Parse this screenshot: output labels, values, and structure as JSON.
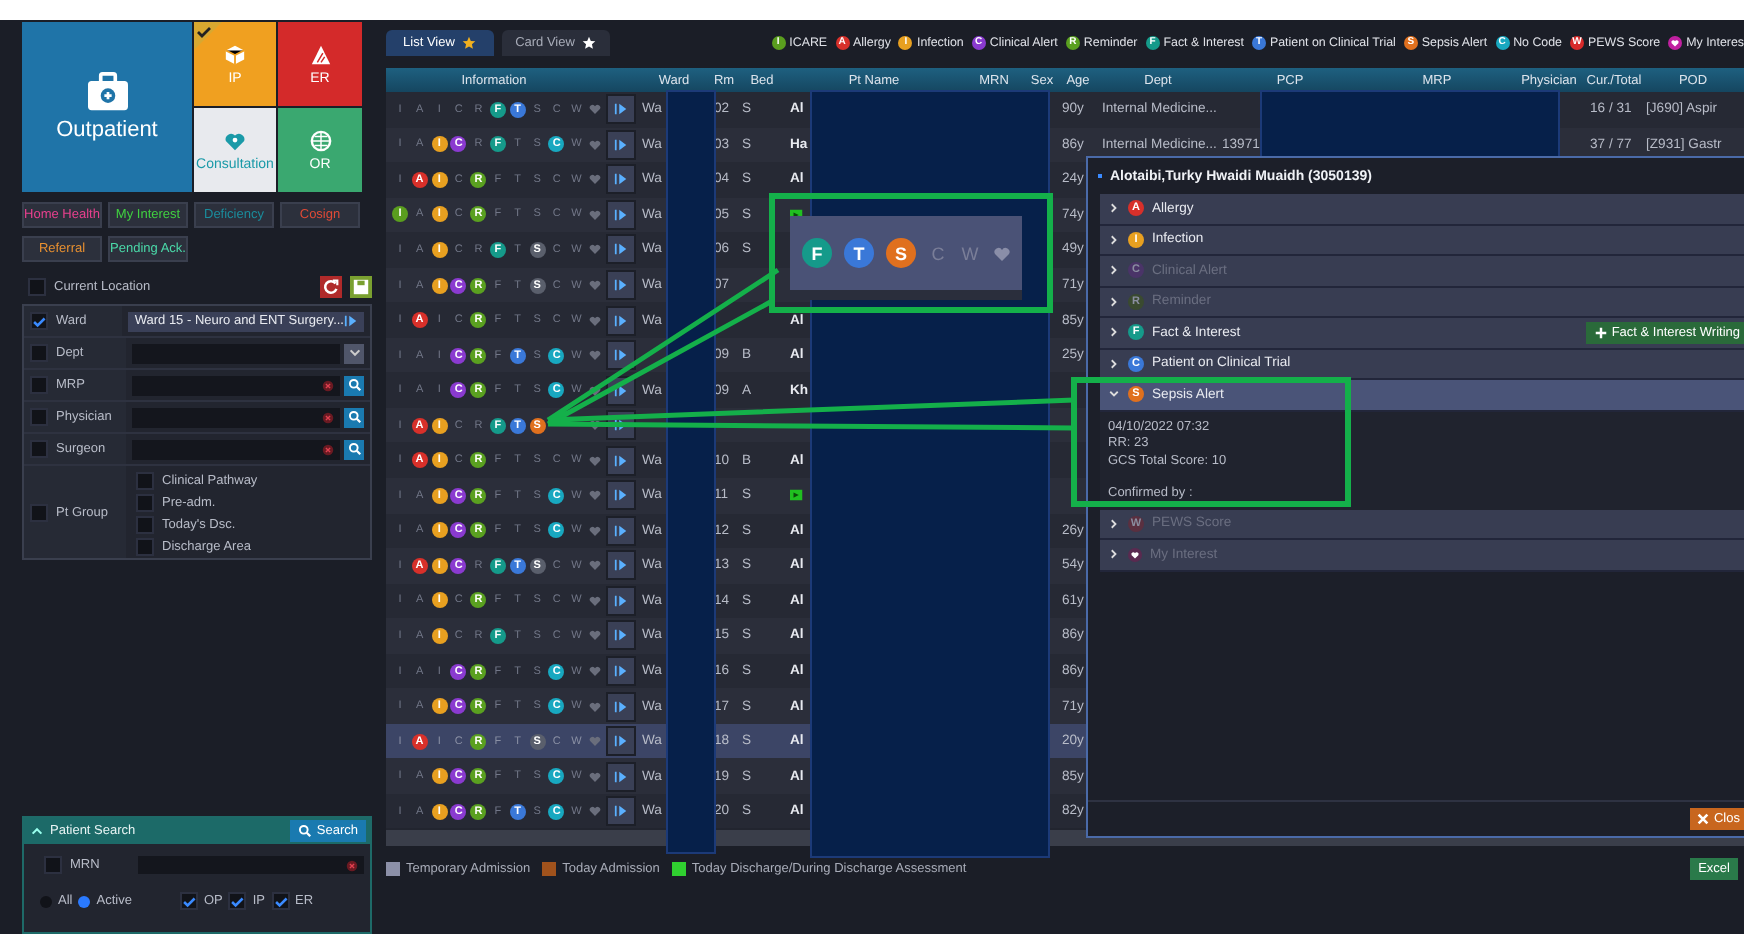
{
  "tiles": [
    {
      "label": "Outpatient",
      "color": "#1f74a8",
      "kind": "large",
      "checked": false
    },
    {
      "label": "IP",
      "color": "#f0a020",
      "kind": "small",
      "checked": true
    },
    {
      "label": "ER",
      "color": "#d42a2a",
      "kind": "small",
      "checked": false
    },
    {
      "label": "Consultation",
      "color": "#e8eaee",
      "kind": "light",
      "checked": false
    },
    {
      "label": "OR",
      "color": "#3aa870",
      "kind": "small",
      "checked": false
    }
  ],
  "quick_buttons": [
    {
      "label": "Home Health",
      "color": "#e8408e"
    },
    {
      "label": "My Interest",
      "color": "#40d040"
    },
    {
      "label": "Deficiency",
      "color": "#1a8c9c"
    },
    {
      "label": "Cosign",
      "color": "#e04a36"
    },
    {
      "label": "Referral",
      "color": "#e89030"
    },
    {
      "label": "Pending Ack.",
      "color": "#4ad8a8"
    }
  ],
  "current_location": {
    "label": "Current Location",
    "checked": false
  },
  "filters": [
    {
      "label": "Ward",
      "checked": true,
      "kind": "select",
      "value": "Ward 15 - Neuro and ENT Surgery..."
    },
    {
      "label": "Dept",
      "checked": false,
      "kind": "dropdown"
    },
    {
      "label": "MRP",
      "checked": false,
      "kind": "search"
    },
    {
      "label": "Physician",
      "checked": false,
      "kind": "search"
    },
    {
      "label": "Surgeon",
      "checked": false,
      "kind": "search"
    },
    {
      "label": "Pt Group",
      "checked": false,
      "kind": "group",
      "options": [
        {
          "label": "Clinical Pathway",
          "checked": false
        },
        {
          "label": "Pre-adm.",
          "checked": false
        },
        {
          "label": "Today's Dsc.",
          "checked": false
        },
        {
          "label": "Discharge Area",
          "checked": false
        }
      ]
    }
  ],
  "patient_search": {
    "title": "Patient Search",
    "button": "Search",
    "mrn": {
      "label": "MRN",
      "checked": false
    },
    "scope": [
      {
        "label": "All",
        "selected": false
      },
      {
        "label": "Active",
        "selected": true
      }
    ],
    "types": [
      {
        "label": "OP",
        "checked": true
      },
      {
        "label": "IP",
        "checked": true
      },
      {
        "label": "ER",
        "checked": true
      }
    ]
  },
  "view_tabs": [
    {
      "label": "List View",
      "selected": true
    },
    {
      "label": "Card View",
      "selected": false
    }
  ],
  "legend": [
    {
      "label": "ICARE",
      "badge": "I",
      "color": "#5a9e1e",
      "kind": "letter"
    },
    {
      "label": "Allergy",
      "badge": "A",
      "color": "#d8302a",
      "kind": "letter"
    },
    {
      "label": "Infection",
      "badge": "I",
      "color": "#e8a020",
      "kind": "letter"
    },
    {
      "label": "Clinical Alert",
      "badge": "C",
      "color": "#8a3ad0",
      "kind": "letter"
    },
    {
      "label": "Reminder",
      "badge": "R",
      "color": "#5aa020",
      "kind": "letter"
    },
    {
      "label": "Fact & Interest",
      "badge": "F",
      "color": "#159a8a",
      "kind": "letter"
    },
    {
      "label": "Patient on Clinical Trial",
      "badge": "T",
      "color": "#3a78d8",
      "kind": "letter"
    },
    {
      "label": "Sepsis Alert",
      "badge": "S",
      "color": "#e0701e",
      "kind": "letter"
    },
    {
      "label": "No Code",
      "badge": "C",
      "color": "#18a8c0",
      "kind": "letter"
    },
    {
      "label": "PEWS Score",
      "badge": "W",
      "color": "#d82a2a",
      "kind": "letter"
    },
    {
      "label": "My Interes",
      "color": "#c020a0",
      "kind": "heart"
    }
  ],
  "columns": [
    "Information",
    "Ward",
    "Rm",
    "Bed",
    "Pt Name",
    "MRN",
    "Sex",
    "Age",
    "Dept",
    "PCP",
    "MRP",
    "Physician",
    "Cur./Total",
    "POD"
  ],
  "rows": [
    {
      "info": [
        {
          "letter": "I",
          "on": false
        },
        {
          "letter": "A",
          "on": false
        },
        {
          "letter": "I",
          "on": false
        },
        {
          "letter": "C",
          "on": false
        },
        {
          "letter": "R",
          "on": false
        },
        {
          "letter": "F",
          "on": true
        },
        {
          "letter": "T",
          "on": true
        },
        {
          "letter": "S",
          "on": false
        },
        {
          "letter": "C",
          "on": false
        },
        {
          "letter": "W",
          "on": false
        }
      ],
      "ward": "Wa",
      "rm": "02",
      "bed": "S",
      "name": "Al",
      "flag": false,
      "age": "90y",
      "dept": "Internal Medicine...",
      "cur_total": "16 / 31",
      "pod": "[J690] Aspir",
      "selected": false
    },
    {
      "info": [
        {
          "letter": "I",
          "on": false
        },
        {
          "letter": "A",
          "on": false
        },
        {
          "letter": "I",
          "on": true
        },
        {
          "letter": "C",
          "on": true
        },
        {
          "letter": "R",
          "on": false
        },
        {
          "letter": "F",
          "on": true
        },
        {
          "letter": "T",
          "on": false
        },
        {
          "letter": "S",
          "on": false
        },
        {
          "letter": "C",
          "on": true
        },
        {
          "letter": "W",
          "on": false
        }
      ],
      "ward": "Wa",
      "rm": "03",
      "bed": "S",
      "name": "Ha",
      "flag": false,
      "age": "86y",
      "dept": "Internal Medicine...",
      "pcp": "13971",
      "cur_total": "37 / 77",
      "pod": "[Z931] Gastr",
      "selected": false
    },
    {
      "info": [
        {
          "letter": "I",
          "on": false
        },
        {
          "letter": "A",
          "on": true
        },
        {
          "letter": "I",
          "on": true
        },
        {
          "letter": "C",
          "on": false
        },
        {
          "letter": "R",
          "on": true
        },
        {
          "letter": "F",
          "on": false
        },
        {
          "letter": "T",
          "on": false
        },
        {
          "letter": "S",
          "on": false
        },
        {
          "letter": "C",
          "on": false
        },
        {
          "letter": "W",
          "on": false
        }
      ],
      "ward": "Wa",
      "rm": "04",
      "bed": "S",
      "name": "Al",
      "flag": false,
      "age": "24y",
      "selected": false
    },
    {
      "info": [
        {
          "letter": "I",
          "on": true
        },
        {
          "letter": "A",
          "on": false
        },
        {
          "letter": "I",
          "on": true
        },
        {
          "letter": "C",
          "on": false
        },
        {
          "letter": "R",
          "on": true
        },
        {
          "letter": "F",
          "on": false
        },
        {
          "letter": "T",
          "on": false
        },
        {
          "letter": "S",
          "on": false
        },
        {
          "letter": "C",
          "on": false
        },
        {
          "letter": "W",
          "on": false
        }
      ],
      "ward": "Wa",
      "rm": "05",
      "bed": "S",
      "flag": true,
      "age": "74y",
      "selected": false
    },
    {
      "info": [
        {
          "letter": "I",
          "on": false
        },
        {
          "letter": "A",
          "on": false
        },
        {
          "letter": "I",
          "on": true
        },
        {
          "letter": "C",
          "on": false
        },
        {
          "letter": "R",
          "on": false
        },
        {
          "letter": "F",
          "on": true
        },
        {
          "letter": "T",
          "on": false
        },
        {
          "letter": "S",
          "on": false,
          "muted": true
        },
        {
          "letter": "C",
          "on": false
        },
        {
          "letter": "W",
          "on": false
        }
      ],
      "ward": "Wa",
      "rm": "06",
      "bed": "S",
      "flag": false,
      "age": "49y",
      "selected": false
    },
    {
      "info": [
        {
          "letter": "I",
          "on": false
        },
        {
          "letter": "A",
          "on": false
        },
        {
          "letter": "I",
          "on": true
        },
        {
          "letter": "C",
          "on": true
        },
        {
          "letter": "R",
          "on": true
        },
        {
          "letter": "F",
          "on": false
        },
        {
          "letter": "T",
          "on": false
        },
        {
          "letter": "S",
          "on": false,
          "muted": true
        },
        {
          "letter": "C",
          "on": false
        },
        {
          "letter": "W",
          "on": false
        }
      ],
      "ward": "Wa",
      "rm": "07",
      "flag": false,
      "age": "71y",
      "selected": false
    },
    {
      "info": [
        {
          "letter": "I",
          "on": false
        },
        {
          "letter": "A",
          "on": true
        },
        {
          "letter": "I",
          "on": false
        },
        {
          "letter": "C",
          "on": false
        },
        {
          "letter": "R",
          "on": true
        },
        {
          "letter": "F",
          "on": false
        },
        {
          "letter": "T",
          "on": false
        },
        {
          "letter": "S",
          "on": false
        },
        {
          "letter": "C",
          "on": false
        },
        {
          "letter": "W",
          "on": false
        }
      ],
      "ward": "Wa",
      "name": "Al",
      "flag": false,
      "age": "85y",
      "selected": false
    },
    {
      "info": [
        {
          "letter": "I",
          "on": false
        },
        {
          "letter": "A",
          "on": false
        },
        {
          "letter": "I",
          "on": false
        },
        {
          "letter": "C",
          "on": true
        },
        {
          "letter": "R",
          "on": true
        },
        {
          "letter": "F",
          "on": false
        },
        {
          "letter": "T",
          "on": true
        },
        {
          "letter": "S",
          "on": false
        },
        {
          "letter": "C",
          "on": true
        },
        {
          "letter": "W",
          "on": false
        }
      ],
      "rm": "09",
      "bed": "B",
      "name": "Al",
      "flag": false,
      "age": "25y",
      "selected": false
    },
    {
      "info": [
        {
          "letter": "I",
          "on": false
        },
        {
          "letter": "A",
          "on": false
        },
        {
          "letter": "I",
          "on": false
        },
        {
          "letter": "C",
          "on": true
        },
        {
          "letter": "R",
          "on": true
        },
        {
          "letter": "F",
          "on": false
        },
        {
          "letter": "T",
          "on": false
        },
        {
          "letter": "S",
          "on": false
        },
        {
          "letter": "C",
          "on": true
        },
        {
          "letter": "W",
          "on": false
        }
      ],
      "ward": "Wa",
      "rm": "09",
      "bed": "A",
      "name": "Kh",
      "flag": false,
      "selected": false
    },
    {
      "info": [
        {
          "letter": "I",
          "on": false
        },
        {
          "letter": "A",
          "on": true
        },
        {
          "letter": "I",
          "on": true
        },
        {
          "letter": "C",
          "on": false
        },
        {
          "letter": "R",
          "on": false
        },
        {
          "letter": "F",
          "on": true
        },
        {
          "letter": "T",
          "on": true
        },
        {
          "letter": "S",
          "on": true
        }
      ],
      "flag": false,
      "selected": false
    },
    {
      "info": [
        {
          "letter": "I",
          "on": false
        },
        {
          "letter": "A",
          "on": true
        },
        {
          "letter": "I",
          "on": true
        },
        {
          "letter": "C",
          "on": false
        },
        {
          "letter": "R",
          "on": true
        },
        {
          "letter": "F",
          "on": false
        },
        {
          "letter": "T",
          "on": false
        },
        {
          "letter": "S",
          "on": false
        },
        {
          "letter": "C",
          "on": false
        },
        {
          "letter": "W",
          "on": false
        }
      ],
      "ward": "Wa",
      "rm": "10",
      "bed": "B",
      "name": "Al",
      "flag": false,
      "selected": false
    },
    {
      "info": [
        {
          "letter": "I",
          "on": false
        },
        {
          "letter": "A",
          "on": false
        },
        {
          "letter": "I",
          "on": true
        },
        {
          "letter": "C",
          "on": true
        },
        {
          "letter": "R",
          "on": true
        },
        {
          "letter": "F",
          "on": false
        },
        {
          "letter": "T",
          "on": false
        },
        {
          "letter": "S",
          "on": false
        },
        {
          "letter": "C",
          "on": true
        },
        {
          "letter": "W",
          "on": false
        }
      ],
      "ward": "Wa",
      "rm": "11",
      "bed": "S",
      "flag": true,
      "selected": false
    },
    {
      "info": [
        {
          "letter": "I",
          "on": false
        },
        {
          "letter": "A",
          "on": false
        },
        {
          "letter": "I",
          "on": true
        },
        {
          "letter": "C",
          "on": true
        },
        {
          "letter": "R",
          "on": true
        },
        {
          "letter": "F",
          "on": false
        },
        {
          "letter": "T",
          "on": false
        },
        {
          "letter": "S",
          "on": false
        },
        {
          "letter": "C",
          "on": true
        },
        {
          "letter": "W",
          "on": false
        }
      ],
      "ward": "Wa",
      "rm": "12",
      "bed": "S",
      "name": "Al",
      "flag": false,
      "age": "26y",
      "selected": false
    },
    {
      "info": [
        {
          "letter": "I",
          "on": false
        },
        {
          "letter": "A",
          "on": true
        },
        {
          "letter": "I",
          "on": true
        },
        {
          "letter": "C",
          "on": true
        },
        {
          "letter": "R",
          "on": false
        },
        {
          "letter": "F",
          "on": true
        },
        {
          "letter": "T",
          "on": true
        },
        {
          "letter": "S",
          "on": false,
          "muted": true
        },
        {
          "letter": "C",
          "on": false
        },
        {
          "letter": "W",
          "on": false
        }
      ],
      "ward": "Wa",
      "rm": "13",
      "bed": "S",
      "name": "Al",
      "flag": false,
      "age": "54y",
      "selected": false
    },
    {
      "info": [
        {
          "letter": "I",
          "on": false
        },
        {
          "letter": "A",
          "on": false
        },
        {
          "letter": "I",
          "on": true
        },
        {
          "letter": "C",
          "on": false
        },
        {
          "letter": "R",
          "on": true
        },
        {
          "letter": "F",
          "on": false
        },
        {
          "letter": "T",
          "on": false
        },
        {
          "letter": "S",
          "on": false
        },
        {
          "letter": "C",
          "on": false
        },
        {
          "letter": "W",
          "on": false
        }
      ],
      "ward": "Wa",
      "rm": "14",
      "bed": "S",
      "name": "Al",
      "flag": false,
      "age": "61y",
      "selected": false
    },
    {
      "info": [
        {
          "letter": "I",
          "on": false
        },
        {
          "letter": "A",
          "on": false
        },
        {
          "letter": "I",
          "on": true
        },
        {
          "letter": "C",
          "on": false
        },
        {
          "letter": "R",
          "on": false
        },
        {
          "letter": "F",
          "on": true
        },
        {
          "letter": "T",
          "on": false
        },
        {
          "letter": "S",
          "on": false
        },
        {
          "letter": "C",
          "on": false
        },
        {
          "letter": "W",
          "on": false
        }
      ],
      "ward": "Wa",
      "rm": "15",
      "bed": "S",
      "name": "Al",
      "flag": false,
      "age": "86y",
      "selected": false
    },
    {
      "info": [
        {
          "letter": "I",
          "on": false
        },
        {
          "letter": "A",
          "on": false
        },
        {
          "letter": "I",
          "on": false
        },
        {
          "letter": "C",
          "on": true
        },
        {
          "letter": "R",
          "on": true
        },
        {
          "letter": "F",
          "on": false
        },
        {
          "letter": "T",
          "on": false
        },
        {
          "letter": "S",
          "on": false
        },
        {
          "letter": "C",
          "on": true
        },
        {
          "letter": "W",
          "on": false
        }
      ],
      "ward": "Wa",
      "rm": "16",
      "bed": "S",
      "name": "Al",
      "flag": false,
      "age": "86y",
      "selected": false
    },
    {
      "info": [
        {
          "letter": "I",
          "on": false
        },
        {
          "letter": "A",
          "on": false
        },
        {
          "letter": "I",
          "on": true
        },
        {
          "letter": "C",
          "on": true
        },
        {
          "letter": "R",
          "on": true
        },
        {
          "letter": "F",
          "on": false
        },
        {
          "letter": "T",
          "on": false
        },
        {
          "letter": "S",
          "on": false
        },
        {
          "letter": "C",
          "on": true
        },
        {
          "letter": "W",
          "on": false
        }
      ],
      "ward": "Wa",
      "rm": "17",
      "bed": "S",
      "name": "Al",
      "flag": false,
      "age": "71y",
      "selected": false
    },
    {
      "info": [
        {
          "letter": "I",
          "on": false
        },
        {
          "letter": "A",
          "on": true
        },
        {
          "letter": "I",
          "on": false
        },
        {
          "letter": "C",
          "on": false
        },
        {
          "letter": "R",
          "on": true
        },
        {
          "letter": "F",
          "on": false
        },
        {
          "letter": "T",
          "on": false
        },
        {
          "letter": "S",
          "on": false,
          "muted": true
        },
        {
          "letter": "C",
          "on": false
        },
        {
          "letter": "W",
          "on": false
        }
      ],
      "ward": "Wa",
      "rm": "18",
      "bed": "S",
      "name": "Al",
      "flag": false,
      "age": "20y",
      "selected": true
    },
    {
      "info": [
        {
          "letter": "I",
          "on": false
        },
        {
          "letter": "A",
          "on": false
        },
        {
          "letter": "I",
          "on": true
        },
        {
          "letter": "C",
          "on": true
        },
        {
          "letter": "R",
          "on": true
        },
        {
          "letter": "F",
          "on": false
        },
        {
          "letter": "T",
          "on": false
        },
        {
          "letter": "S",
          "on": false
        },
        {
          "letter": "C",
          "on": true
        },
        {
          "letter": "W",
          "on": false
        }
      ],
      "ward": "Wa",
      "rm": "19",
      "bed": "S",
      "name": "Al",
      "flag": false,
      "age": "85y",
      "selected": false
    },
    {
      "info": [
        {
          "letter": "I",
          "on": false
        },
        {
          "letter": "A",
          "on": false
        },
        {
          "letter": "I",
          "on": true
        },
        {
          "letter": "C",
          "on": true
        },
        {
          "letter": "R",
          "on": true
        },
        {
          "letter": "F",
          "on": false
        },
        {
          "letter": "T",
          "on": true
        },
        {
          "letter": "S",
          "on": false
        },
        {
          "letter": "C",
          "on": true
        },
        {
          "letter": "W",
          "on": false
        }
      ],
      "ward": "Wa",
      "rm": "20",
      "bed": "S",
      "name": "Al",
      "flag": false,
      "age": "82y",
      "selected": false
    }
  ],
  "popup": {
    "title": "Alotaibi,Turky Hwaidi Muaidh (3050139)",
    "sections": [
      {
        "label": "Allergy",
        "badge": "A",
        "color": "#d8302a",
        "kind": "letter",
        "enabled": true,
        "expanded": false
      },
      {
        "label": "Infection",
        "badge": "I",
        "color": "#e8a020",
        "kind": "letter",
        "enabled": true,
        "expanded": false
      },
      {
        "label": "Clinical Alert",
        "badge": "C",
        "color": "#4a3468",
        "kind": "letter",
        "enabled": false,
        "expanded": false
      },
      {
        "label": "Reminder",
        "badge": "R",
        "color": "#3a4a30",
        "kind": "letter",
        "enabled": false,
        "expanded": false
      },
      {
        "label": "Fact & Interest",
        "badge": "F",
        "color": "#159a8a",
        "kind": "letter",
        "enabled": true,
        "expanded": false,
        "action": "Fact & Interest Writing"
      },
      {
        "label": "Patient on Clinical Trial",
        "badge": "C",
        "color": "#3a78d8",
        "kind": "letter",
        "enabled": true,
        "expanded": false
      },
      {
        "label": "Sepsis Alert",
        "badge": "S",
        "color": "#e0701e",
        "kind": "letter",
        "enabled": true,
        "expanded": true,
        "details": [
          "04/10/2022 07:32",
          "RR: 23",
          "GCS Total Score: 10"
        ],
        "confirmed": "Confirmed by :"
      },
      {
        "label": "PEWS Score",
        "badge": "W",
        "color": "#5a3040",
        "kind": "letter",
        "enabled": false,
        "expanded": false
      },
      {
        "label": "My Interest",
        "color": "#5a2a50",
        "kind": "heart",
        "enabled": false,
        "expanded": false
      }
    ],
    "close": "Clos"
  },
  "callout": {
    "badges": [
      {
        "letter": "F",
        "on": true,
        "color": "#159a8a"
      },
      {
        "letter": "T",
        "on": true,
        "color": "#3a78d8"
      },
      {
        "letter": "S",
        "on": true,
        "color": "#e0701e"
      },
      {
        "letter": "C",
        "on": false
      },
      {
        "letter": "W",
        "on": false
      }
    ]
  },
  "bottom_legend": [
    {
      "label": "Temporary Admission",
      "color": "#8c90a8"
    },
    {
      "label": "Today Admission",
      "color": "#a0521c"
    },
    {
      "label": "Today Discharge/During Discharge Assessment",
      "color": "#30d030"
    }
  ],
  "excel": "Excel"
}
